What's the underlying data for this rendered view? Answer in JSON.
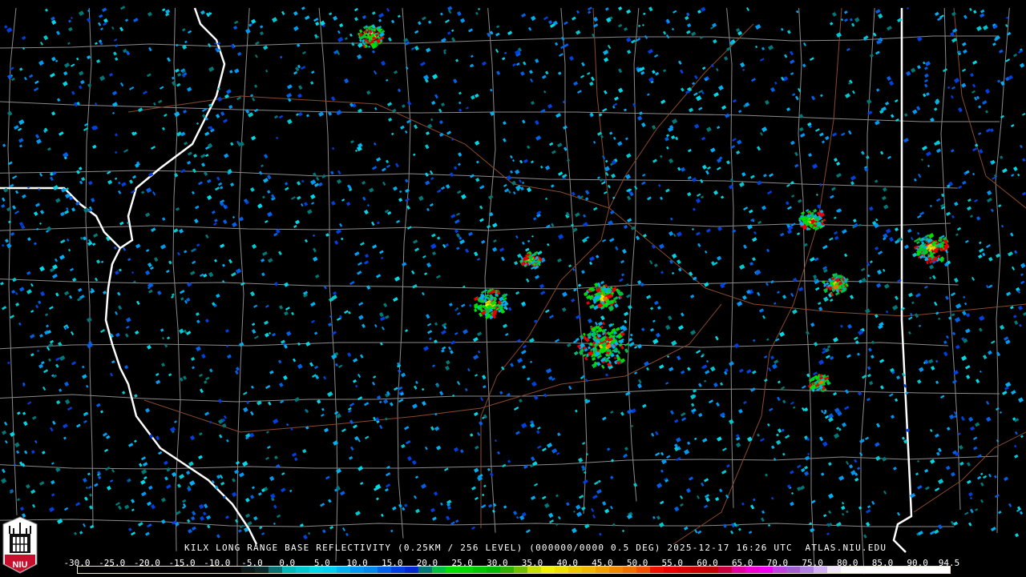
{
  "caption": {
    "radar": "KILX",
    "product": "LONG RANGE BASE REFLECTIVITY",
    "resolution": "(0.25KM / 256 LEVEL)",
    "tilt": "(000000/0000 0.5 DEG)",
    "date": "2025-12-17",
    "time": "16:26 UTC",
    "site": "ATLAS.NIU.EDU"
  },
  "logo": {
    "text": "NIU"
  },
  "colorbar": {
    "min": -30.0,
    "max": 94.5,
    "tick_labels": [
      "-30.0",
      "-25.0",
      "-20.0",
      "-15.0",
      "-10.0",
      "-5.0",
      "0.0",
      "5.0",
      "10.0",
      "15.0",
      "20.0",
      "25.0",
      "30.0",
      "35.0",
      "40.0",
      "45.0",
      "50.0",
      "55.0",
      "60.0",
      "65.0",
      "70.0",
      "75.0",
      "80.0",
      "85.0",
      "90.0",
      "94.5"
    ],
    "colors": [
      "#000000",
      "#000000",
      "#000000",
      "#000000",
      "#000000",
      "#000000",
      "#000000",
      "#000000",
      "#000000",
      "#000000",
      "#000000",
      "#000000",
      "#0a1a1a",
      "#0d2a2a",
      "#0a7070",
      "#00b8b8",
      "#00c8d0",
      "#00d8e8",
      "#00d0f0",
      "#00b0f0",
      "#0098f0",
      "#0088ea",
      "#0060e8",
      "#0040e0",
      "#0028d0",
      "#007878",
      "#00c040",
      "#00e000",
      "#00d800",
      "#00c800",
      "#00b800",
      "#30b000",
      "#70c000",
      "#c8e000",
      "#f0f000",
      "#f0e000",
      "#f0c800",
      "#f0b800",
      "#f0a000",
      "#f08800",
      "#f07000",
      "#f05000",
      "#f01000",
      "#e80000",
      "#d80000",
      "#c80000",
      "#c00000",
      "#c80040",
      "#e000a0",
      "#f000d0",
      "#f000f0",
      "#c040e0",
      "#a060d0",
      "#b080e0",
      "#d0b0f0",
      "#f0e8f8",
      "#ffffff",
      "#ffffff",
      "#ffffff",
      "#ffffff",
      "#ffffff",
      "#ffffff",
      "#ffffff",
      "#ffffff"
    ]
  }
}
